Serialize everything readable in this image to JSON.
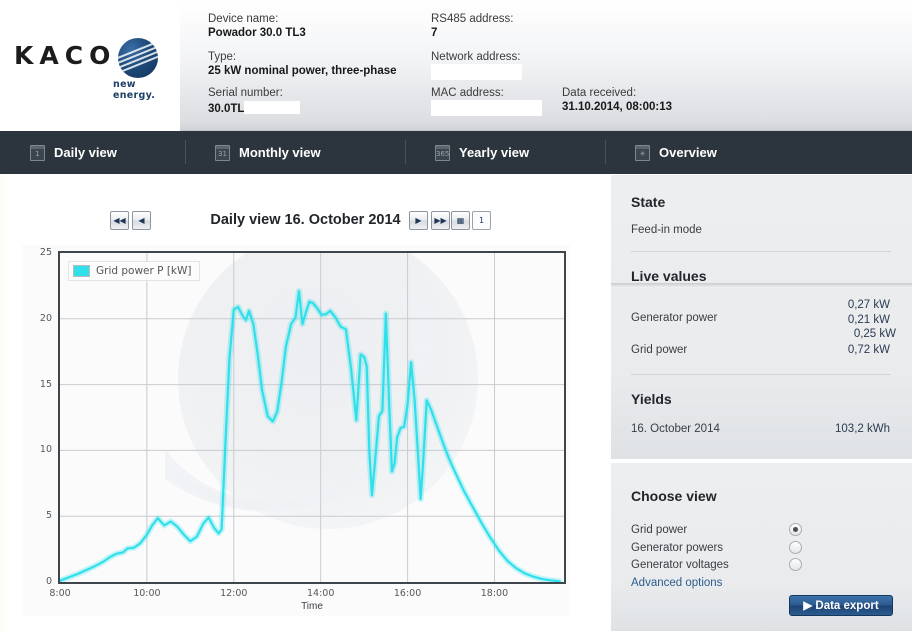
{
  "brand": {
    "name": "KACO",
    "tagline": "new energy."
  },
  "device_info": {
    "device_name_label": "Device name:",
    "device_name_value": "Powador 30.0 TL3",
    "type_label": "Type:",
    "type_value": "25 kW nominal power, three-phase",
    "serial_label": "Serial number:",
    "serial_value": "30.0TL",
    "rs485_label": "RS485 address:",
    "rs485_value": "7",
    "network_label": "Network address:",
    "network_value": "",
    "mac_label": "MAC address:",
    "mac_value": "",
    "data_received_label": "Data received:",
    "data_received_value": "31.10.2014, 08:00:13"
  },
  "nav": {
    "tabs": [
      {
        "label": "Daily view",
        "icon": "calendar-day-icon",
        "glyph": "1",
        "active": true
      },
      {
        "label": "Monthly view",
        "icon": "calendar-month-icon",
        "glyph": "31",
        "active": false
      },
      {
        "label": "Yearly view",
        "icon": "calendar-year-icon",
        "glyph": "365",
        "active": false
      },
      {
        "label": "Overview",
        "icon": "asterisk-icon",
        "glyph": "✳",
        "active": false
      }
    ]
  },
  "chart_nav": {
    "title": "Daily view 16. October 2014",
    "first_label": "◀◀",
    "prev_label": "◀",
    "next_label": "▶",
    "last_label": "▶▶",
    "calendar_label": "▦",
    "today_label": "1"
  },
  "chart_data": {
    "type": "line",
    "title": "Daily view 16. October 2014",
    "xlabel": "Time",
    "ylabel": "",
    "legend": [
      "Grid power P [kW]"
    ],
    "legend_position": "top-left",
    "series_color": "#2fe0ea",
    "grid": true,
    "xlim": [
      8,
      19.6
    ],
    "ylim": [
      0,
      25
    ],
    "yticks": [
      0,
      5,
      10,
      15,
      20,
      25
    ],
    "xticks": [
      8,
      10,
      12,
      14,
      16,
      18
    ],
    "xtick_labels": [
      "8:00",
      "10:00",
      "12:00",
      "14:00",
      "16:00",
      "18:00"
    ],
    "series": [
      {
        "name": "Grid power P [kW]",
        "unit": "kW",
        "x": [
          8.0,
          8.2,
          8.4,
          8.6,
          8.8,
          9.0,
          9.15,
          9.3,
          9.45,
          9.55,
          9.7,
          9.85,
          10.0,
          10.12,
          10.25,
          10.4,
          10.55,
          10.7,
          10.85,
          11.0,
          11.15,
          11.3,
          11.42,
          11.55,
          11.65,
          11.72,
          11.8,
          11.9,
          12.0,
          12.1,
          12.2,
          12.28,
          12.35,
          12.45,
          12.55,
          12.65,
          12.78,
          12.9,
          13.0,
          13.1,
          13.2,
          13.32,
          13.42,
          13.5,
          13.58,
          13.66,
          13.74,
          13.82,
          13.92,
          14.02,
          14.12,
          14.22,
          14.34,
          14.46,
          14.58,
          14.7,
          14.82,
          14.92,
          15.0,
          15.06,
          15.12,
          15.18,
          15.26,
          15.34,
          15.42,
          15.5,
          15.58,
          15.64,
          15.7,
          15.76,
          15.84,
          15.92,
          16.0,
          16.08,
          16.16,
          16.24,
          16.3,
          16.36,
          16.44,
          16.54,
          16.66,
          16.8,
          16.95,
          17.1,
          17.3,
          17.5,
          17.7,
          17.9,
          18.1,
          18.3,
          18.5,
          18.7,
          18.9,
          19.1,
          19.3,
          19.5
        ],
        "y": [
          0.1,
          0.35,
          0.6,
          0.9,
          1.2,
          1.55,
          1.9,
          2.15,
          2.25,
          2.55,
          2.6,
          2.95,
          3.6,
          4.3,
          4.85,
          4.3,
          4.6,
          4.2,
          3.6,
          3.1,
          3.45,
          4.45,
          4.9,
          4.1,
          3.7,
          4.0,
          10.0,
          17.0,
          20.7,
          20.9,
          20.25,
          19.9,
          20.6,
          19.6,
          17.3,
          14.6,
          12.6,
          12.2,
          12.95,
          15.2,
          17.9,
          19.6,
          20.1,
          22.1,
          19.6,
          20.5,
          21.3,
          21.2,
          20.8,
          20.3,
          20.35,
          20.6,
          20.1,
          19.4,
          19.2,
          16.2,
          12.3,
          17.3,
          17.1,
          16.4,
          9.9,
          6.6,
          9.5,
          12.6,
          13.0,
          20.4,
          13.2,
          8.4,
          9.0,
          11.0,
          11.7,
          11.8,
          13.5,
          16.7,
          13.9,
          9.7,
          6.3,
          9.2,
          13.8,
          13.1,
          12.0,
          10.7,
          9.4,
          8.3,
          6.9,
          5.7,
          4.5,
          3.4,
          2.4,
          1.6,
          1.05,
          0.65,
          0.4,
          0.22,
          0.12,
          0.05
        ]
      }
    ]
  },
  "sidebar": {
    "state": {
      "title": "State",
      "value": "Feed-in mode"
    },
    "live_values": {
      "title": "Live values",
      "rows": [
        {
          "label": "Generator power",
          "values": [
            "0,27 kW",
            "0,21 kW",
            "0,25 kW"
          ]
        },
        {
          "label": "Grid power",
          "values": [
            "0,72 kW"
          ]
        }
      ]
    },
    "yields": {
      "title": "Yields",
      "rows": [
        {
          "label": "16. October 2014",
          "value": "103,2 kWh"
        }
      ]
    },
    "choose_view": {
      "title": "Choose view",
      "options": [
        {
          "label": "Grid power",
          "selected": true
        },
        {
          "label": "Generator powers",
          "selected": false
        },
        {
          "label": "Generator voltages",
          "selected": false
        }
      ],
      "advanced_link": "Advanced options",
      "export_button": "▶ Data export"
    }
  }
}
